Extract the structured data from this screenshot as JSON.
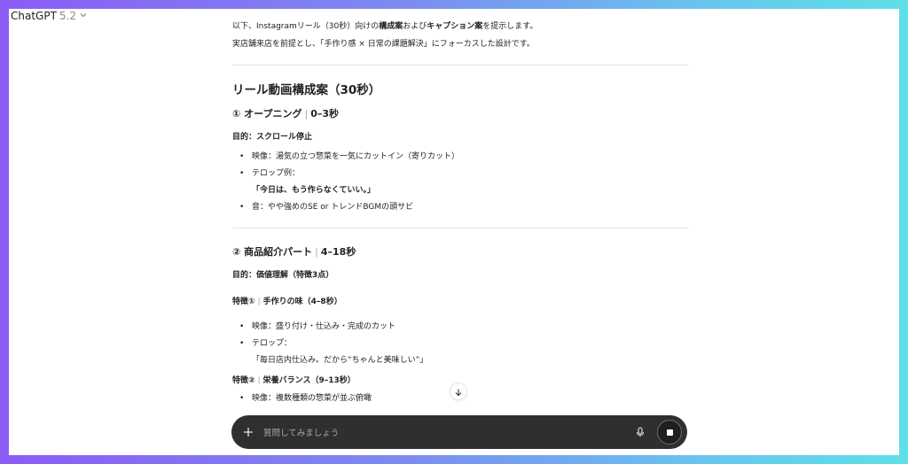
{
  "app": {
    "title": "ChatGPT",
    "version": "5.2"
  },
  "intro": {
    "line1": "以下、Instagramリール（30秒）向けの構成案およびキャプション案を提示します。",
    "line2": "実店舗来店を前提とし、「手作り感 × 日常の課題解決」にフォーカスした設計です。"
  },
  "main_title": "リール動画構成案（30秒）",
  "sections": [
    {
      "title": "① オープニング",
      "time": "0–3秒",
      "goal": "目的：スクロール停止",
      "items": [
        {
          "text": "映像：湯気の立つ惣菜を一気にカットイン（寄りカット）"
        },
        {
          "text": "テロップ例：",
          "sub": "「今日は、もう作らなくていい。」"
        },
        {
          "text": "音：やや強めのSE or トレンドBGMの頭サビ"
        }
      ]
    },
    {
      "title": "② 商品紹介パート",
      "time": "4–18秒",
      "goal": "目的：価値理解（特徴3点）",
      "features": [
        {
          "title": "特徴①",
          "detail": "手作りの味（4–8秒）",
          "items": [
            {
              "text": "映像：盛り付け・仕込み・完成のカット"
            },
            {
              "text": "テロップ：",
              "sub": "「毎日店内仕込み。だから“ちゃんと美味しい”」"
            }
          ]
        },
        {
          "title": "特徴②",
          "detail": "栄養バランス（9–13秒）",
          "items": [
            {
              "text": "映像：複数種類の惣菜が並ぶ俯瞰"
            }
          ]
        }
      ]
    }
  ],
  "composer": {
    "placeholder": "質問してみましょう"
  },
  "icons": {
    "version_chevron": "chevron-down-icon",
    "scroll": "arrow-down-icon",
    "plus": "plus-icon",
    "mic": "microphone-icon",
    "stop": "stop-icon"
  }
}
